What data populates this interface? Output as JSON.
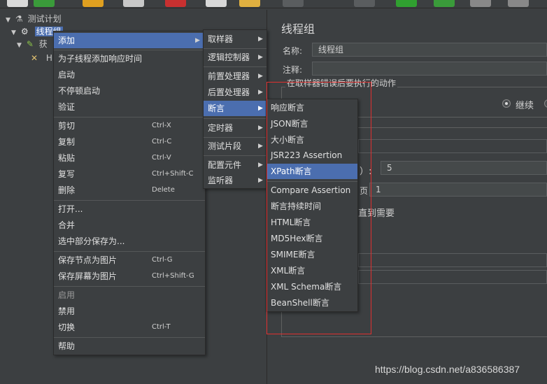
{
  "tree": {
    "root_label": "测试计划",
    "thread_group_label": "线程组",
    "child_label": "获",
    "grandchild_label": "H"
  },
  "right_panel": {
    "title": "线程组",
    "name_label": "名称:",
    "name_value": "线程组",
    "comment_label": "注释:",
    "error_group_title": "在取样器错误后要执行的动作",
    "continue_label": "继续",
    "field_suffix_1": "）:",
    "threads_value": "5",
    "ramp_suffix": "页",
    "ramp_value": "1",
    "until_needed": "直到需要"
  },
  "context_menu": {
    "items": [
      {
        "label": "添加",
        "submenu": true,
        "selected": true
      },
      {
        "label": "为子线程添加响应时间"
      },
      {
        "label": "启动"
      },
      {
        "label": "不停顿启动"
      },
      {
        "label": "验证"
      },
      {
        "label": "剪切",
        "shortcut": "Ctrl-X"
      },
      {
        "label": "复制",
        "shortcut": "Ctrl-C"
      },
      {
        "label": "粘贴",
        "shortcut": "Ctrl-V"
      },
      {
        "label": "复写",
        "shortcut": "Ctrl+Shift-C"
      },
      {
        "label": "删除",
        "shortcut": "Delete"
      },
      {
        "label": "打开..."
      },
      {
        "label": "合并"
      },
      {
        "label": "选中部分保存为..."
      },
      {
        "label": "保存节点为图片",
        "shortcut": "Ctrl-G"
      },
      {
        "label": "保存屏幕为图片",
        "shortcut": "Ctrl+Shift-G"
      },
      {
        "label": "启用",
        "disabled": true
      },
      {
        "label": "禁用"
      },
      {
        "label": "切换",
        "shortcut": "Ctrl-T"
      },
      {
        "label": "帮助"
      }
    ]
  },
  "add_submenu": {
    "items": [
      {
        "label": "取样器"
      },
      {
        "label": "逻辑控制器"
      },
      {
        "label": "前置处理器"
      },
      {
        "label": "后置处理器"
      },
      {
        "label": "断言",
        "selected": true
      },
      {
        "label": "定时器"
      },
      {
        "label": "测试片段"
      },
      {
        "label": "配置元件"
      },
      {
        "label": "监听器"
      }
    ]
  },
  "assertion_submenu": {
    "items": [
      {
        "label": "响应断言"
      },
      {
        "label": "JSON断言"
      },
      {
        "label": "大小断言"
      },
      {
        "label": "JSR223 Assertion"
      },
      {
        "label": "XPath断言",
        "selected": true
      },
      {
        "label": "Compare Assertion"
      },
      {
        "label": "断言持续时间"
      },
      {
        "label": "HTML断言"
      },
      {
        "label": "MD5Hex断言"
      },
      {
        "label": "SMIME断言"
      },
      {
        "label": "XML断言"
      },
      {
        "label": "XML Schema断言"
      },
      {
        "label": "BeanShell断言"
      }
    ]
  },
  "icons": {
    "arrow_right": "▶",
    "arrow_down": "▼"
  },
  "colors": {
    "selection": "#4b6eaf",
    "highlight_box": "#e03030"
  },
  "watermark": "https://blog.csdn.net/a836586387"
}
